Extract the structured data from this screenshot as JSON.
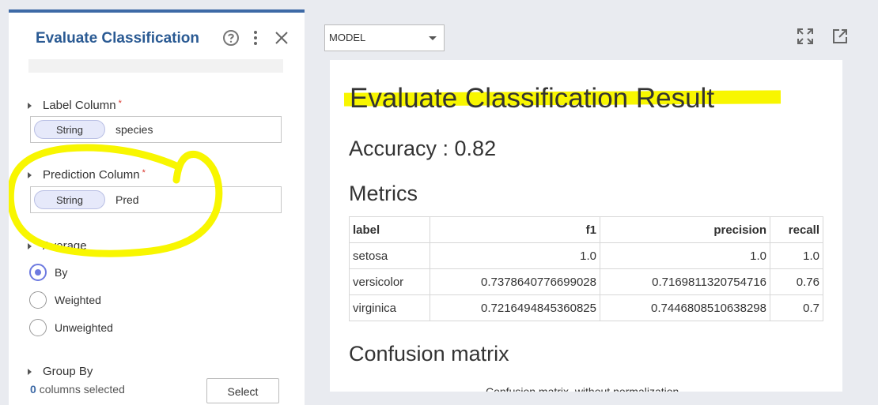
{
  "panel": {
    "title": "Evaluate Classification",
    "label_column": {
      "label": "Label Column",
      "required": "*",
      "type": "String",
      "value": "species"
    },
    "prediction_column": {
      "label": "Prediction Column",
      "required": "*",
      "type": "String",
      "value": "Pred"
    },
    "average": {
      "label": "Average",
      "options": [
        {
          "label": "By",
          "checked": true
        },
        {
          "label": "Weighted",
          "checked": false
        },
        {
          "label": "Unweighted",
          "checked": false
        }
      ]
    },
    "group_by": {
      "label": "Group By",
      "count": "0",
      "count_text": "columns selected",
      "button": "Select"
    }
  },
  "toolbar": {
    "select_value": "MODEL"
  },
  "result": {
    "title": "Evaluate Classification Result",
    "accuracy": "Accuracy : 0.82",
    "metrics_title": "Metrics",
    "table": {
      "headers": [
        "label",
        "f1",
        "precision",
        "recall"
      ],
      "rows": [
        [
          "setosa",
          "1.0",
          "1.0",
          "1.0"
        ],
        [
          "versicolor",
          "0.7378640776699028",
          "0.7169811320754716",
          "0.76"
        ],
        [
          "virginica",
          "0.7216494845360825",
          "0.7446808510638298",
          "0.7"
        ]
      ]
    },
    "confusion_title": "Confusion matrix",
    "confusion_subtitle": "Confusion matrix, without normalization"
  },
  "colors": {
    "accent": "#3e6aa6",
    "title": "#2a5a93",
    "radio": "#6d7ae0",
    "highlight": "#f8f600",
    "required": "#d9342b"
  }
}
